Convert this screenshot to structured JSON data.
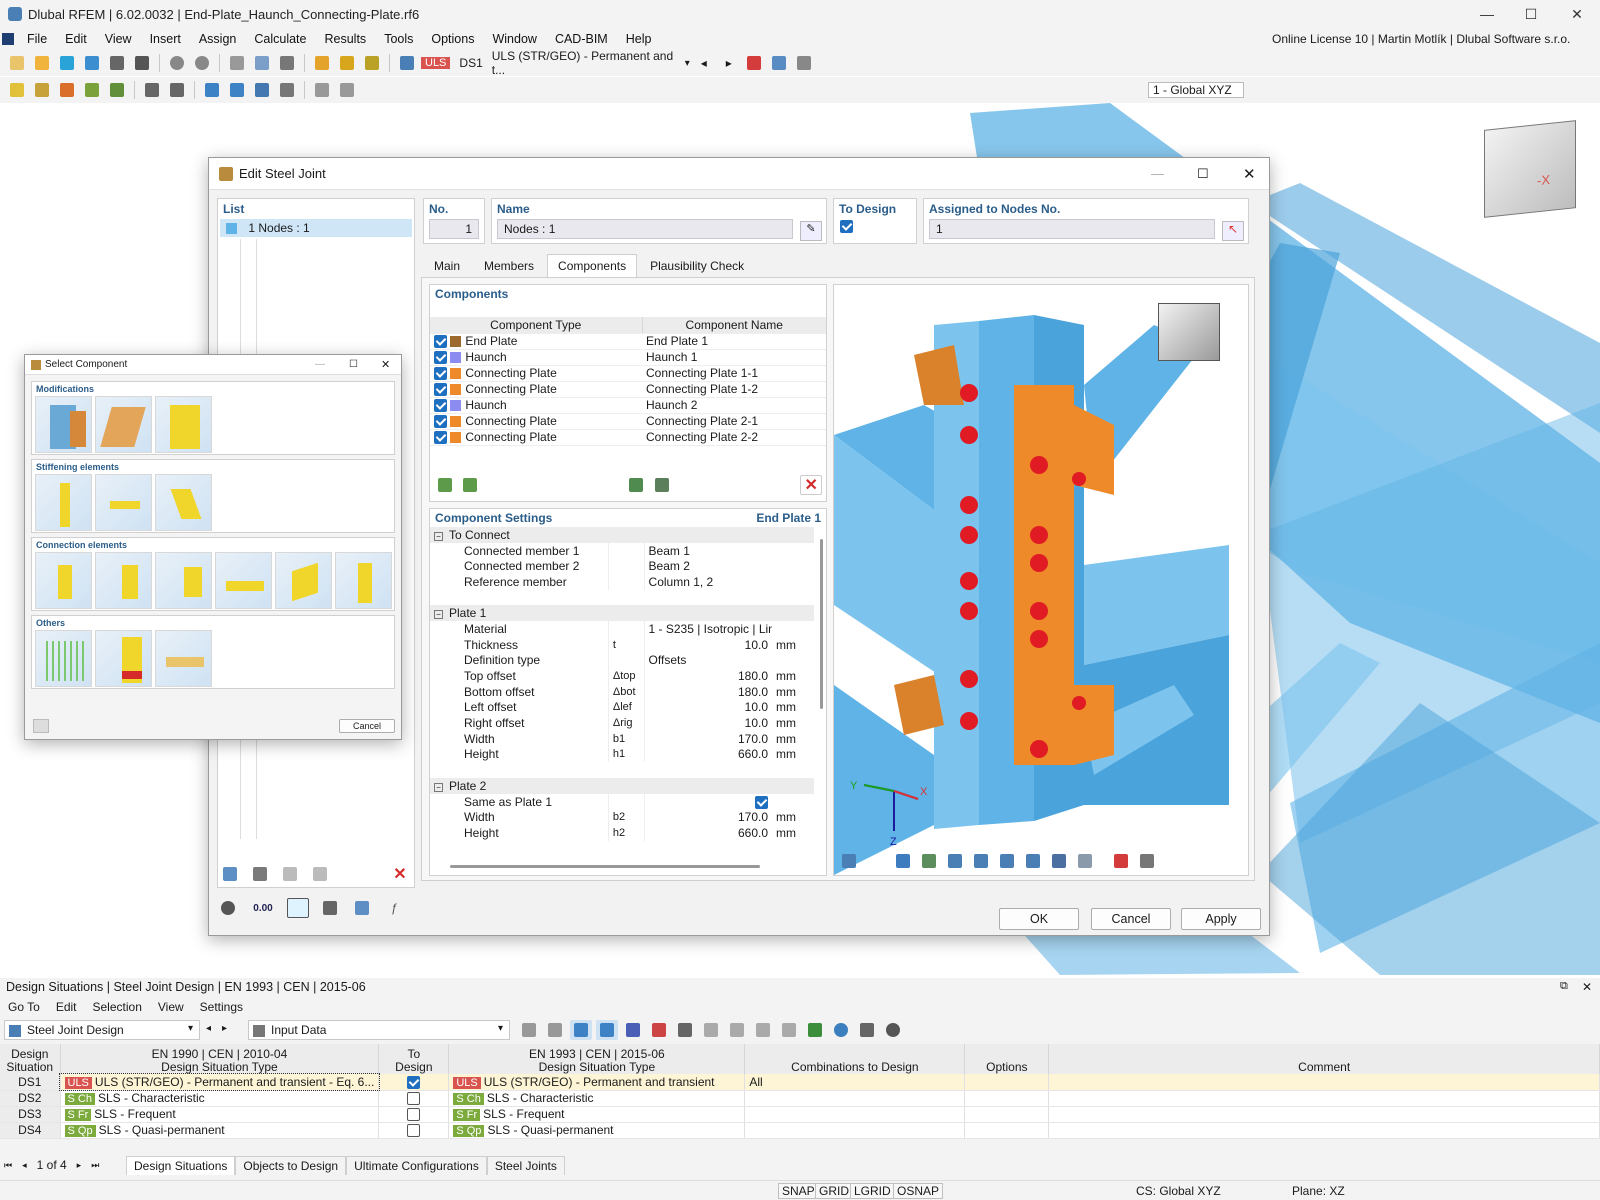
{
  "app": {
    "title": "Dlubal RFEM | 6.02.0032 | End-Plate_Haunch_Connecting-Plate.rf6",
    "license": "Online License 10 | Martin Motlík | Dlubal Software s.r.o."
  },
  "menu": [
    "File",
    "Edit",
    "View",
    "Insert",
    "Assign",
    "Calculate",
    "Results",
    "Tools",
    "Options",
    "Window",
    "CAD-BIM",
    "Help"
  ],
  "toolbar": {
    "uls_badge": "ULS",
    "ds": "DS1",
    "ds_desc": "ULS (STR/GEO) - Permanent and t...",
    "cs": "1 - Global XYZ"
  },
  "colors": {
    "uls": "#d9534f",
    "sls": "#7caa3c",
    "steel": "#5fb3e6",
    "plate": "#ef8a2b",
    "haunch": "#8b8bf0",
    "accent": "#1f6fc1"
  },
  "dialog": {
    "title": "Edit Steel Joint",
    "list_header": "List",
    "list_item": "1   Nodes : 1",
    "no_label": "No.",
    "no_value": "1",
    "name_label": "Name",
    "name_value": "Nodes : 1",
    "to_design_label": "To Design",
    "assigned_label": "Assigned to Nodes No.",
    "assigned_value": "1",
    "tabs": [
      "Main",
      "Members",
      "Components",
      "Plausibility Check"
    ],
    "components_header": "Components",
    "col_type": "Component Type",
    "col_name": "Component Name",
    "components": [
      {
        "type": "End Plate",
        "name": "End Plate 1",
        "color": "#9c6a2c"
      },
      {
        "type": "Haunch",
        "name": "Haunch 1",
        "color": "#8b8bf0"
      },
      {
        "type": "Connecting Plate",
        "name": "Connecting Plate 1-1",
        "color": "#ef8a2b"
      },
      {
        "type": "Connecting Plate",
        "name": "Connecting Plate 1-2",
        "color": "#ef8a2b"
      },
      {
        "type": "Haunch",
        "name": "Haunch 2",
        "color": "#8b8bf0"
      },
      {
        "type": "Connecting Plate",
        "name": "Connecting Plate 2-1",
        "color": "#ef8a2b"
      },
      {
        "type": "Connecting Plate",
        "name": "Connecting Plate 2-2",
        "color": "#ef8a2b"
      }
    ],
    "settings_header": "Component Settings",
    "settings_target": "End Plate 1",
    "settings": [
      {
        "kind": "group",
        "label": "To Connect"
      },
      {
        "label": "Connected member 1",
        "sym": "",
        "value": "Beam 1",
        "unit": ""
      },
      {
        "label": "Connected member 2",
        "sym": "",
        "value": "Beam 2",
        "unit": ""
      },
      {
        "label": "Reference member",
        "sym": "",
        "value": "Column 1, 2",
        "unit": ""
      },
      {
        "kind": "blank"
      },
      {
        "kind": "group",
        "label": "Plate 1"
      },
      {
        "label": "Material",
        "sym": "",
        "value": "1 - S235 | Isotropic | Linear El...",
        "unit": ""
      },
      {
        "label": "Thickness",
        "sym": "t",
        "value": "10.0",
        "unit": "mm"
      },
      {
        "label": "Definition type",
        "sym": "",
        "value": "Offsets",
        "unit": ""
      },
      {
        "label": "Top offset",
        "sym": "Δtop",
        "value": "180.0",
        "unit": "mm"
      },
      {
        "label": "Bottom offset",
        "sym": "Δbot",
        "value": "180.0",
        "unit": "mm"
      },
      {
        "label": "Left offset",
        "sym": "Δlef",
        "value": "10.0",
        "unit": "mm"
      },
      {
        "label": "Right offset",
        "sym": "Δrig",
        "value": "10.0",
        "unit": "mm"
      },
      {
        "label": "Width",
        "sym": "b1",
        "value": "170.0",
        "unit": "mm"
      },
      {
        "label": "Height",
        "sym": "h1",
        "value": "660.0",
        "unit": "mm"
      },
      {
        "kind": "blank"
      },
      {
        "kind": "group",
        "label": "Plate 2"
      },
      {
        "label": "Same as Plate 1",
        "sym": "",
        "value": "",
        "unit": "",
        "check": true
      },
      {
        "label": "Width",
        "sym": "b2",
        "value": "170.0",
        "unit": "mm"
      },
      {
        "label": "Height",
        "sym": "h2",
        "value": "660.0",
        "unit": "mm"
      }
    ],
    "ok": "OK",
    "cancel": "Cancel",
    "apply": "Apply",
    "field_value": "0.00"
  },
  "select_component": {
    "title": "Select Component",
    "groups": [
      {
        "label": "Modifications",
        "count": 3
      },
      {
        "label": "Stiffening elements",
        "count": 3
      },
      {
        "label": "Connection elements",
        "count": 6
      },
      {
        "label": "Others",
        "count": 3
      }
    ],
    "cancel": "Cancel"
  },
  "bottom": {
    "title": "Design Situations | Steel Joint Design | EN 1993 | CEN | 2015-06",
    "menu": [
      "Go To",
      "Edit",
      "Selection",
      "View",
      "Settings"
    ],
    "module": "Steel Joint Design",
    "view": "Input Data",
    "headers": {
      "ds": "Design\nSituation",
      "en1990": "EN 1990 | CEN | 2010-04",
      "ds_type": "Design Situation Type",
      "to_design": "To\nDesign",
      "en1993": "EN 1993 | CEN | 2015-06",
      "ds_type2": "Design Situation Type",
      "combos": "Combinations to Design",
      "options": "Options",
      "comment": "Comment"
    },
    "rows": [
      {
        "ds": "DS1",
        "b1": "ULS",
        "t1": "ULS (STR/GEO) - Permanent and transient - Eq. 6...",
        "check": true,
        "b2": "ULS",
        "t2": "ULS (STR/GEO) - Permanent and transient",
        "combo": "All"
      },
      {
        "ds": "DS2",
        "b1": "S Ch",
        "t1": "SLS - Characteristic",
        "check": false,
        "b2": "S Ch",
        "t2": "SLS - Characteristic",
        "combo": ""
      },
      {
        "ds": "DS3",
        "b1": "S Fr",
        "t1": "SLS - Frequent",
        "check": false,
        "b2": "S Fr",
        "t2": "SLS - Frequent",
        "combo": ""
      },
      {
        "ds": "DS4",
        "b1": "S Qp",
        "t1": "SLS - Quasi-permanent",
        "check": false,
        "b2": "S Qp",
        "t2": "SLS - Quasi-permanent",
        "combo": ""
      }
    ],
    "pager": "1 of 4",
    "tabs": [
      "Design Situations",
      "Objects to Design",
      "Ultimate Configurations",
      "Steel Joints"
    ]
  },
  "status": {
    "items": [
      "SNAP",
      "GRID",
      "LGRID",
      "OSNAP"
    ],
    "cs": "CS: Global XYZ",
    "plane": "Plane: XZ"
  },
  "axes": {
    "y": "Y",
    "x": "X",
    "z": "Z"
  },
  "cube_label": "-X"
}
